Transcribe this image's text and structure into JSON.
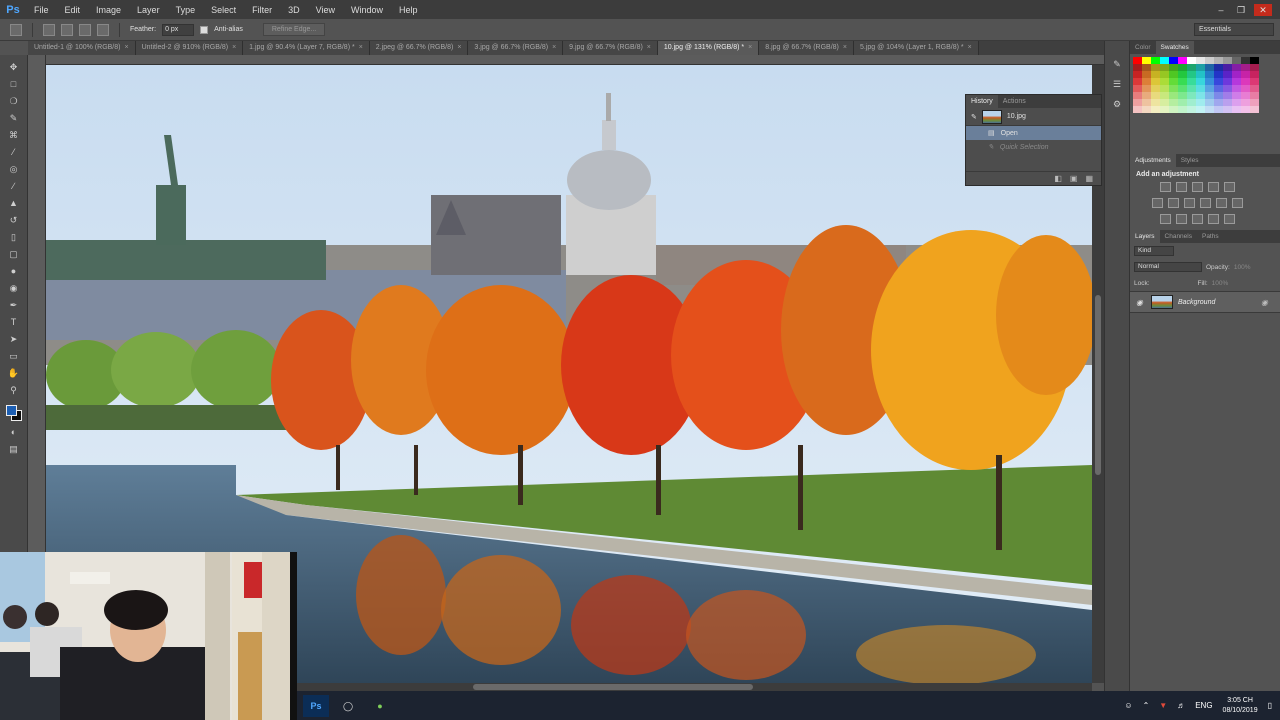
{
  "app": {
    "logo": "Ps"
  },
  "menu": [
    "File",
    "Edit",
    "Image",
    "Layer",
    "Type",
    "Select",
    "Filter",
    "3D",
    "View",
    "Window",
    "Help"
  ],
  "options_bar": {
    "feather_label": "Feather:",
    "feather_value": "0 px",
    "antialias_label": "Anti-alias",
    "refine_edge": "Refine Edge...",
    "workspace": "Essentials"
  },
  "tabs": [
    {
      "label": "Untitled-1 @ 100% (RGB/8)",
      "active": false
    },
    {
      "label": "Untitled-2 @ 910% (RGB/8)",
      "active": false
    },
    {
      "label": "1.jpg @ 90.4% (Layer 7, RGB/8) *",
      "active": false
    },
    {
      "label": "2.jpeg @ 66.7% (RGB/8)",
      "active": false
    },
    {
      "label": "3.jpg @ 66.7% (RGB/8)",
      "active": false
    },
    {
      "label": "9.jpg @ 66.7% (RGB/8)",
      "active": false
    },
    {
      "label": "10.jpg @ 131% (RGB/8) *",
      "active": true
    },
    {
      "label": "8.jpg @ 66.7% (RGB/8)",
      "active": false
    },
    {
      "label": "5.jpg @ 104% (Layer 1, RGB/8) *",
      "active": false
    }
  ],
  "history_panel": {
    "tabs": [
      "History",
      "Actions"
    ],
    "snapshot": "10.jpg",
    "states": [
      {
        "label": "Open",
        "selected": true
      },
      {
        "label": "Quick Selection",
        "selected": false
      }
    ]
  },
  "swatches_panel": {
    "tabs": [
      "Color",
      "Swatches"
    ],
    "active_tab": "Swatches"
  },
  "adjustments_panel": {
    "tabs": [
      "Adjustments",
      "Styles"
    ],
    "title": "Add an adjustment"
  },
  "layers_panel": {
    "tabs": [
      "Layers",
      "Channels",
      "Paths"
    ],
    "filter": "Kind",
    "blend_mode": "Normal",
    "opacity_label": "Opacity:",
    "opacity_value": "100%",
    "lock_label": "Lock:",
    "fill_label": "Fill:",
    "fill_value": "100%",
    "layers": [
      {
        "name": "Background",
        "locked": true
      }
    ]
  },
  "colors": {
    "foreground": "#1d5fb3",
    "background": "#0d0d0d",
    "accent": "#4fa7ff"
  },
  "taskbar": {
    "apps": [
      "photoshop-icon",
      "chrome-icon",
      "app-icon"
    ],
    "language": "ENG",
    "time": "3:05 CH",
    "date": "08/10/2019"
  }
}
